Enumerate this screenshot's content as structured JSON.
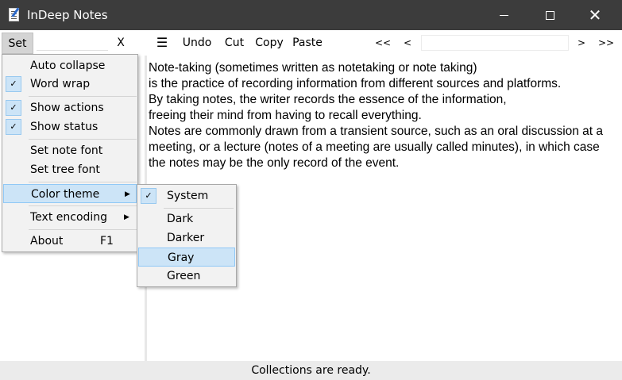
{
  "window": {
    "title": "InDeep Notes",
    "minimize_icon": "minimize-icon",
    "maximize_icon": "maximize-icon",
    "close_icon": "close-icon",
    "close_glyph": "✕"
  },
  "toolbar": {
    "set_label": "Set",
    "clear_label": "X",
    "menu_glyph": "☰",
    "undo_label": "Undo",
    "cut_label": "Cut",
    "copy_label": "Copy",
    "paste_label": "Paste",
    "first_label": "<<",
    "prev_label": "<",
    "next_label": ">",
    "last_label": ">>"
  },
  "note": {
    "lines": [
      "Note-taking (sometimes written as notetaking or note taking)",
      "is the practice of recording information from different sources and platforms.",
      "By taking notes, the writer records the essence of the information,",
      "freeing their mind from having to recall everything.",
      "Notes are commonly drawn from a transient source, such as an oral discussion at a",
      "meeting, or a lecture (notes of a meeting are usually called minutes), in which case",
      "the notes may be the only record of the event."
    ]
  },
  "status": {
    "text": "Collections are ready."
  },
  "settings_menu": {
    "check_glyph": "✓",
    "submenu_arrow": "▶",
    "items": [
      {
        "label": "Auto collapse",
        "checked": false
      },
      {
        "label": "Word wrap",
        "checked": true
      },
      {
        "label": "Show actions",
        "checked": true
      },
      {
        "label": "Show status",
        "checked": true
      },
      {
        "label": "Set note font",
        "checked": false
      },
      {
        "label": "Set tree font",
        "checked": false
      },
      {
        "label": "Color theme",
        "checked": false,
        "submenu": true,
        "highlighted": true
      },
      {
        "label": "Text encoding",
        "checked": false,
        "submenu": true
      },
      {
        "label": "About",
        "shortcut": "F1",
        "checked": false
      }
    ]
  },
  "color_theme_menu": {
    "items": [
      {
        "label": "System",
        "checked": true
      },
      {
        "label": "Dark",
        "checked": false
      },
      {
        "label": "Darker",
        "checked": false
      },
      {
        "label": "Gray",
        "checked": false,
        "highlighted": true
      },
      {
        "label": "Green",
        "checked": false
      }
    ]
  },
  "colors": {
    "titlebar": "#3c3c3c",
    "highlight": "#cce4f7",
    "highlight_border": "#90c8f6",
    "statusbar": "#ebebeb"
  }
}
